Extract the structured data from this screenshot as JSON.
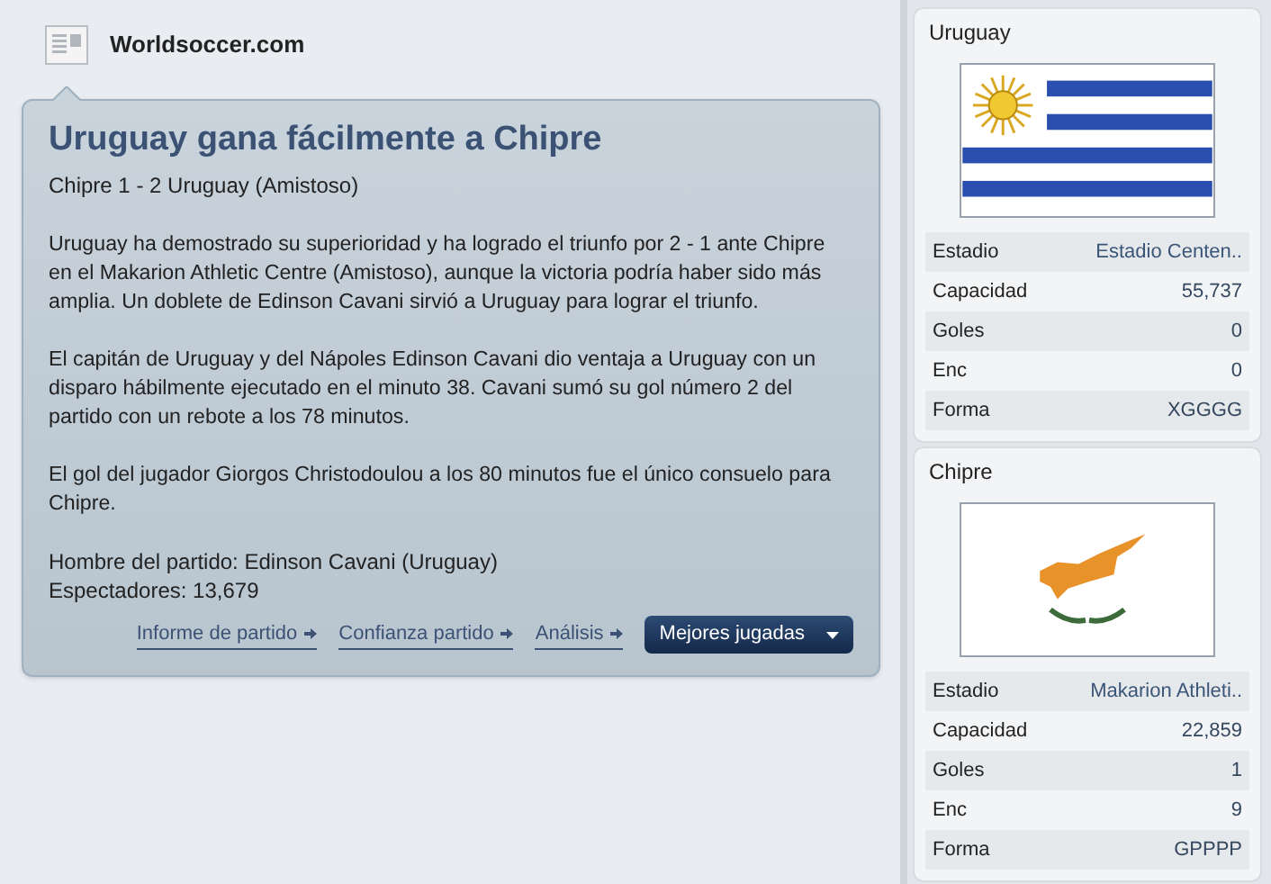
{
  "source": {
    "name": "Worldsoccer.com"
  },
  "article": {
    "title": "Uruguay gana fácilmente a Chipre",
    "subtitle": "Chipre 1 - 2 Uruguay (Amistoso)",
    "paragraphs": [
      "Uruguay ha demostrado su superioridad y ha logrado el triunfo por 2 - 1 ante Chipre en el Makarion Athletic Centre (Amistoso), aunque la victoria podría haber sido más amplia. Un doblete de Edinson Cavani sirvió a Uruguay para lograr el triunfo.",
      "El capitán de Uruguay y del Nápoles Edinson Cavani dio ventaja a Uruguay con un disparo hábilmente ejecutado en el minuto 38. Cavani sumó su gol número 2 del partido con un rebote a los 78 minutos.",
      "El gol del jugador Giorgos Christodoulou a los 80 minutos fue el único consuelo para Chipre."
    ],
    "facts": [
      "Hombre del partido: Edinson Cavani (Uruguay)",
      "Espectadores: 13,679"
    ],
    "links": [
      "Informe de partido",
      "Confianza partido",
      "Análisis"
    ],
    "button": "Mejores jugadas"
  },
  "teams": [
    {
      "name": "Uruguay",
      "kind": "uruguay",
      "stats": [
        {
          "label": "Estadio",
          "value": "Estadio Centen.."
        },
        {
          "label": "Capacidad",
          "value": "55,737"
        },
        {
          "label": "Goles",
          "value": "0"
        },
        {
          "label": "Enc",
          "value": "0"
        },
        {
          "label": "Forma",
          "value": "XGGGG"
        }
      ]
    },
    {
      "name": "Chipre",
      "kind": "cyprus",
      "stats": [
        {
          "label": "Estadio",
          "value": "Makarion Athleti.."
        },
        {
          "label": "Capacidad",
          "value": "22,859"
        },
        {
          "label": "Goles",
          "value": "1"
        },
        {
          "label": "Enc",
          "value": "9"
        },
        {
          "label": "Forma",
          "value": "GPPPP"
        }
      ]
    }
  ]
}
